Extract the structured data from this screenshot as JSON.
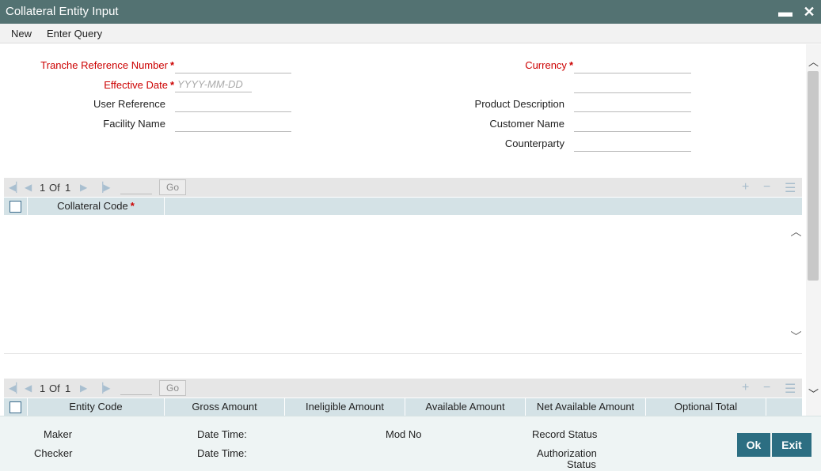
{
  "window": {
    "title": "Collateral Entity Input",
    "minimize_glyph": "▬",
    "close_glyph": "✕"
  },
  "menu": {
    "new_label": "New",
    "enter_query_label": "Enter Query"
  },
  "form": {
    "tranche_reference_number": {
      "label": "Tranche Reference Number",
      "value": ""
    },
    "effective_date": {
      "label": "Effective Date",
      "value": "",
      "placeholder": "YYYY-MM-DD"
    },
    "user_reference": {
      "label": "User Reference",
      "value": ""
    },
    "facility_name": {
      "label": "Facility Name",
      "value": ""
    },
    "currency": {
      "label": "Currency",
      "value": ""
    },
    "currency_secondary": {
      "value": ""
    },
    "product_description": {
      "label": "Product Description",
      "value": ""
    },
    "customer_name": {
      "label": "Customer Name",
      "value": ""
    },
    "counterparty": {
      "label": "Counterparty",
      "value": ""
    },
    "required_marker": "*"
  },
  "collateral_grid": {
    "page_current": "1",
    "page_of": "Of",
    "page_total": "1",
    "go_label": "Go",
    "columns": [
      "Collateral Code"
    ],
    "rows": []
  },
  "entity_grid": {
    "page_current": "1",
    "page_of": "Of",
    "page_total": "1",
    "go_label": "Go",
    "columns": [
      "Entity Code",
      "Gross Amount",
      "Ineligible Amount",
      "Available Amount",
      "Net Available Amount",
      "Optional Total"
    ],
    "rows": []
  },
  "icons": {
    "first": "first-page-icon",
    "prev": "prev-page-icon",
    "next": "next-page-icon",
    "last": "last-page-icon",
    "add": "add-row-icon",
    "delete": "delete-row-icon",
    "view": "single-view-icon"
  },
  "footer": {
    "maker_label": "Maker",
    "checker_label": "Checker",
    "date_time_label_1": "Date Time:",
    "date_time_label_2": "Date Time:",
    "mod_no_label": "Mod No",
    "record_status_label": "Record Status",
    "authorization_label": "Authorization",
    "status_label": "Status",
    "ok_label": "Ok",
    "exit_label": "Exit"
  },
  "colors": {
    "title_bar": "#537272",
    "required": "#cc0000",
    "button": "#2c6e82",
    "grid_header": "#d4e2e6"
  }
}
